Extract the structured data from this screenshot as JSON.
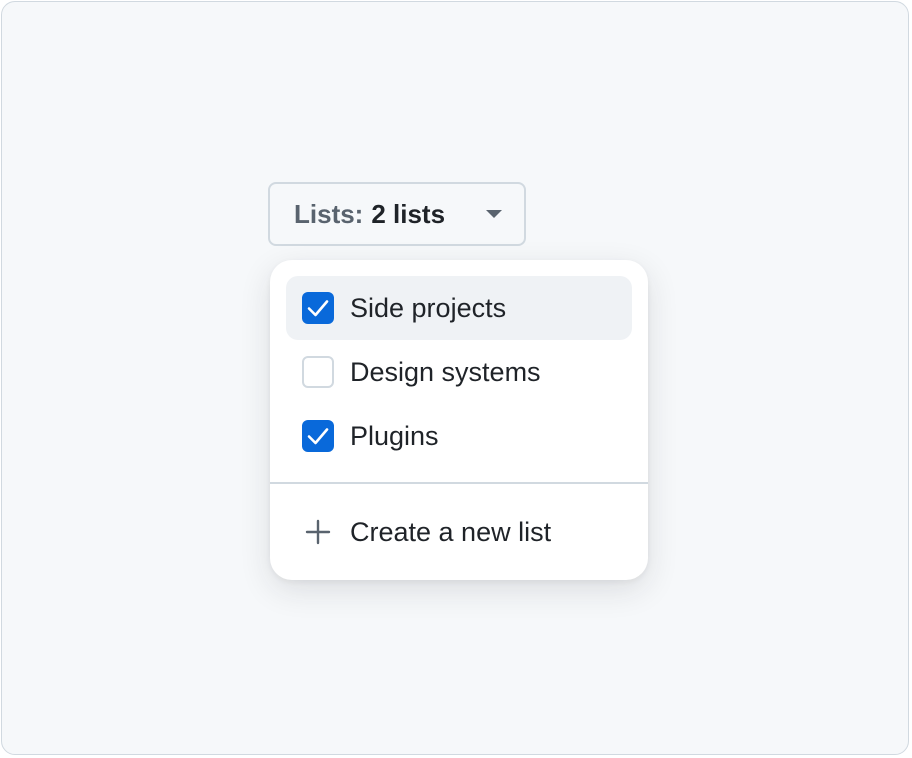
{
  "lists_selector": {
    "prefix": "Lists:",
    "value": "2 lists",
    "caret_icon": "triangle-down-icon"
  },
  "menu": {
    "items": [
      {
        "label": "Side projects",
        "checked": true,
        "highlighted": true
      },
      {
        "label": "Design systems",
        "checked": false,
        "highlighted": false
      },
      {
        "label": "Plugins",
        "checked": true,
        "highlighted": false
      }
    ],
    "create_label": "Create a new list",
    "create_icon": "plus-icon",
    "check_icon": "checkmark-icon"
  },
  "colors": {
    "accent": "#0969da",
    "highlight": "#eff2f5",
    "border": "#d1d9e0",
    "muted_text": "#59636e",
    "text": "#1f2328",
    "canvas": "#f6f8fa"
  }
}
